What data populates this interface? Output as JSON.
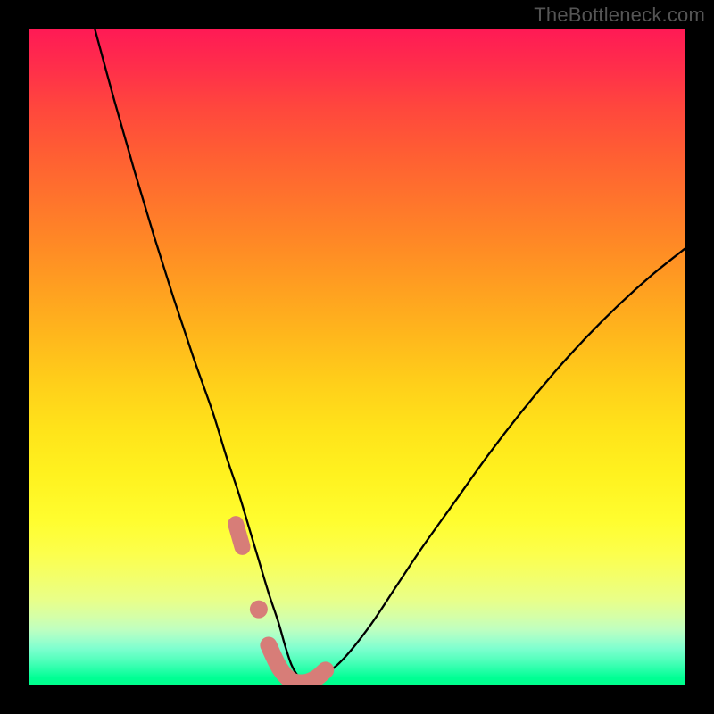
{
  "watermark": "TheBottleneck.com",
  "chart_data": {
    "type": "line",
    "title": "",
    "xlabel": "",
    "ylabel": "",
    "xlim": [
      0,
      100
    ],
    "ylim": [
      0,
      100
    ],
    "series": [
      {
        "name": "bottleneck-curve",
        "x": [
          10,
          13,
          16,
          19,
          22,
          25,
          28,
          30,
          32,
          33.5,
          35,
          36.5,
          38,
          39,
          40,
          41,
          42,
          45,
          48,
          52,
          56,
          60,
          65,
          70,
          75,
          80,
          85,
          90,
          95,
          100
        ],
        "y": [
          100,
          89,
          78.5,
          68.5,
          59,
          50,
          41.5,
          35,
          29,
          24,
          19,
          14,
          9.5,
          6,
          3,
          1.3,
          0.5,
          1.5,
          4,
          9,
          15,
          21,
          28,
          35,
          41.5,
          47.5,
          53,
          58,
          62.5,
          66.5
        ]
      }
    ],
    "annotations": [
      {
        "name": "left-marker-segment",
        "type": "thick-line",
        "color": "#d77d78",
        "points": [
          {
            "x": 31.5,
            "y": 24.5
          },
          {
            "x": 32.5,
            "y": 21.0
          }
        ]
      },
      {
        "name": "middle-marker-dot",
        "type": "dot",
        "color": "#d77d78",
        "point": {
          "x": 35.0,
          "y": 11.5
        }
      },
      {
        "name": "right-marker-segment",
        "type": "thick-line",
        "color": "#d77d78",
        "points": [
          {
            "x": 36.5,
            "y": 6.0
          },
          {
            "x": 38.2,
            "y": 2.5
          },
          {
            "x": 40.0,
            "y": 0.6
          },
          {
            "x": 42.0,
            "y": 0.3
          },
          {
            "x": 43.8,
            "y": 1.0
          },
          {
            "x": 45.2,
            "y": 2.2
          }
        ]
      }
    ],
    "background_gradient": {
      "top_color": "#ff1a55",
      "mid_color": "#ffe31a",
      "bottom_color": "#00ff8c"
    }
  }
}
